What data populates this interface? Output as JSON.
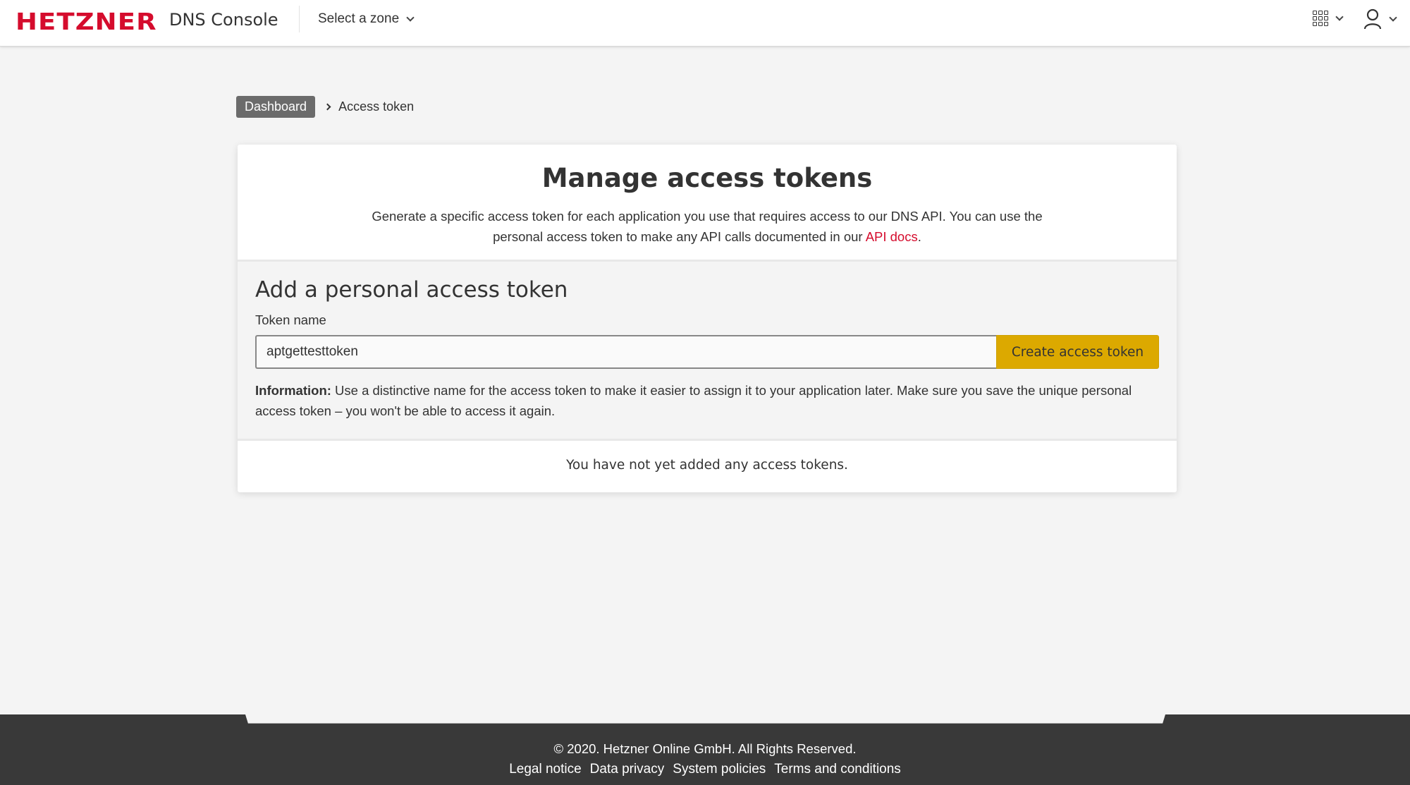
{
  "header": {
    "logo": "HETZNER",
    "product": "DNS Console",
    "zone_select": "Select a zone",
    "apps_icon": "grid-icon",
    "user_icon": "user-icon"
  },
  "breadcrumb": {
    "home": "Dashboard",
    "current": "Access token"
  },
  "card": {
    "title": "Manage access tokens",
    "desc_line": "Generate a specific access token for each application you use that requires access to our DNS API. You can use the personal access token to make any API calls documented in our ",
    "desc_link": "API docs",
    "desc_end": ".",
    "add_title": "Add a personal access token",
    "field_label": "Token name",
    "field_value": "aptgettesttoken",
    "button": "Create access token",
    "info_label": "Information:",
    "info_text": " Use a distinctive name for the access token to make it easier to assign it to your application later. Make sure you save the unique personal access token – you won't be able to access it again.",
    "empty": "You have not yet added any access tokens."
  },
  "footer": {
    "copyright": "© 2020. Hetzner Online GmbH. All Rights Reserved.",
    "links": [
      "Legal notice",
      "Data privacy",
      "System policies",
      "Terms and conditions"
    ]
  },
  "colors": {
    "brand": "#d50c2d",
    "button": "#dca900",
    "footer_bg": "#393939"
  }
}
